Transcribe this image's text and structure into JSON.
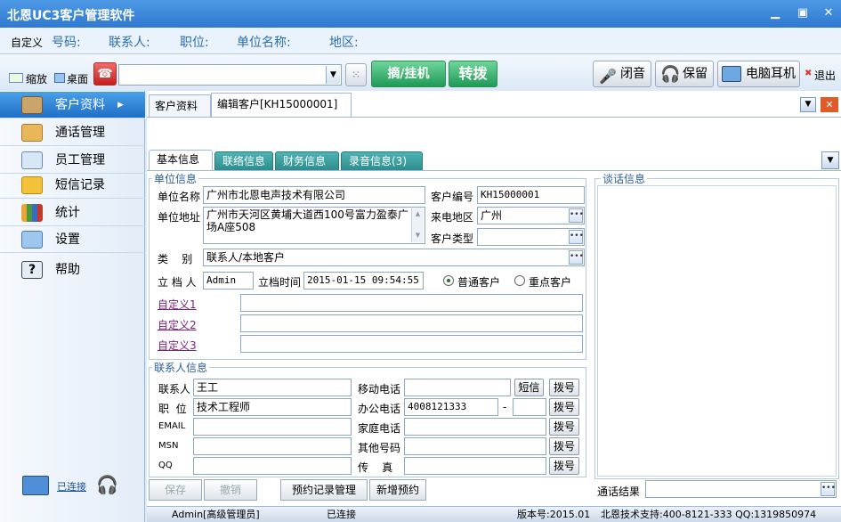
{
  "window": {
    "title": "北恩UC3客户管理软件"
  },
  "infobar": {
    "custom": "自定义",
    "number": "号码:",
    "contact": "联系人:",
    "position": "职位:",
    "company": "单位名称:",
    "region": "地区:"
  },
  "toolbar": {
    "zoom": "缩放",
    "desktop": "桌面",
    "dial_hangup": "摘/挂机",
    "transfer": "转拨",
    "mute": "闭音",
    "hold": "保留",
    "headset": "电脑耳机",
    "exit": "退出"
  },
  "sidebar": {
    "items": [
      {
        "label": "客户资料"
      },
      {
        "label": "通话管理"
      },
      {
        "label": "员工管理"
      },
      {
        "label": "短信记录"
      },
      {
        "label": "统计"
      },
      {
        "label": "设置"
      },
      {
        "label": "帮助"
      }
    ],
    "connected": "已连接"
  },
  "tabs": {
    "t1": "客户资料",
    "t2": "编辑客户[KH15000001]"
  },
  "subtabs": {
    "s1": "基本信息",
    "s2": "联络信息",
    "s3": "财务信息",
    "s4": "录音信息(3)"
  },
  "unit": {
    "group": "单位信息",
    "name_label": "单位名称",
    "name": "广州市北恩电声技术有限公司",
    "code_label": "客户编号",
    "code": "KH15000001",
    "addr_label": "单位地址",
    "addr": "广州市天河区黄埔大道西100号富力盈泰广场A座508",
    "area_label": "来电地区",
    "area": "广州",
    "type_label": "客户类型",
    "type": "",
    "cat_label": "类    别",
    "cat": "联系人/本地客户",
    "creator_label": "立 档 人",
    "creator": "Admin",
    "time_label": "立档时间",
    "time": "2015-01-15 09:54:55",
    "normal": "普通客户",
    "key": "重点客户",
    "c1": "自定义1",
    "c2": "自定义2",
    "c3": "自定义3"
  },
  "contact": {
    "group": "联系人信息",
    "name_label": "联系人",
    "name": "王工",
    "pos_label": "职  位",
    "pos": "技术工程师",
    "email_label": "EMAIL",
    "msn_label": "MSN",
    "qq_label": "QQ",
    "mobile_label": "移动电话",
    "office_label": "办公电话",
    "office": "4008121333",
    "dash": "-",
    "home_label": "家庭电话",
    "other_label": "其他号码",
    "fax_label": "传    真",
    "sms": "短信",
    "dial": "拨号"
  },
  "buttons": {
    "save": "保存",
    "cancel": "撤销",
    "appt": "预约记录管理",
    "new_appt": "新增预约"
  },
  "talk": {
    "group": "谈话信息",
    "result_label": "通话结果"
  },
  "status": {
    "user": "Admin[高级管理员]",
    "conn": "已连接",
    "version": "版本号:2015.01",
    "support": "北恩技术支持:400-8121-333 QQ:1319850974"
  }
}
